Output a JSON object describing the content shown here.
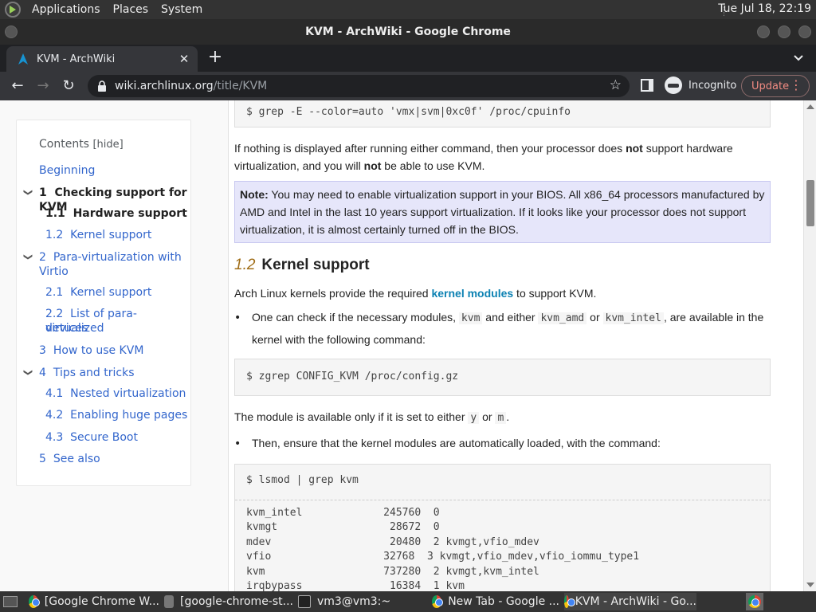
{
  "system_panel": {
    "menus": [
      "Applications",
      "Places",
      "System"
    ],
    "clock": "Tue Jul 18, 22:19"
  },
  "window": {
    "title": "KVM - ArchWiki - Google Chrome"
  },
  "tab": {
    "title": "KVM - ArchWiki",
    "close": "✕",
    "new_tab": "+"
  },
  "toolbar": {
    "url_host": "wiki.archlinux.org",
    "url_path": "/title/KVM",
    "incognito_label": "Incognito",
    "update_label": "Update"
  },
  "toc": {
    "title": "Contents",
    "hide": "[hide]",
    "items": [
      {
        "num": "",
        "label": "Beginning"
      },
      {
        "num": "1",
        "label": "Checking support for KVM"
      },
      {
        "num": "1.1",
        "label": "Hardware support"
      },
      {
        "num": "1.2",
        "label": "Kernel support"
      },
      {
        "num": "2",
        "label": "Para-virtualization with"
      },
      {
        "num": "",
        "label": "Virtio"
      },
      {
        "num": "2.1",
        "label": "Kernel support"
      },
      {
        "num": "2.2",
        "label": "List of para-virtualized"
      },
      {
        "num": "",
        "label": "devices"
      },
      {
        "num": "3",
        "label": "How to use KVM"
      },
      {
        "num": "4",
        "label": "Tips and tricks"
      },
      {
        "num": "4.1",
        "label": "Nested virtualization"
      },
      {
        "num": "4.2",
        "label": "Enabling huge pages"
      },
      {
        "num": "4.3",
        "label": "Secure Boot"
      },
      {
        "num": "5",
        "label": "See also"
      }
    ]
  },
  "content": {
    "code1": "$ grep -E --color=auto 'vmx|svm|0xc0f' /proc/cpuinfo",
    "p1_a": "If nothing is displayed after running either command, then your processor does ",
    "p1_not": "not",
    "p1_b": " support hardware virtualization, and you will ",
    "p1_not2": "not",
    "p1_c": " be able to use KVM.",
    "note_label": "Note:",
    "note_text": " You may need to enable virtualization support in your BIOS. All x86_64 processors manufactured by AMD and Intel in the last 10 years support virtualization. If it looks like your processor does not support virtualization, it is almost certainly turned off in the BIOS.",
    "heading_num": "1.2",
    "heading_text": "Kernel support",
    "p2_a": "Arch Linux kernels provide the required ",
    "p2_link": "kernel modules",
    "p2_b": " to support KVM.",
    "bullet1_a": "One can check if the necessary modules, ",
    "bullet1_kvm": "kvm",
    "bullet1_b": " and either ",
    "bullet1_amd": "kvm_amd",
    "bullet1_c": " or ",
    "bullet1_intel": "kvm_intel",
    "bullet1_d": ", are available in the kernel with the following command:",
    "code2": "$ zgrep CONFIG_KVM /proc/config.gz",
    "p3_a": "The module is available only if it is set to either ",
    "p3_y": "y",
    "p3_b": " or ",
    "p3_m": "m",
    "p3_c": ".",
    "bullet2": "Then, ensure that the kernel modules are automatically loaded, with the command:",
    "code3": "$ lsmod | grep kvm",
    "output": [
      "kvm_intel             245760  0",
      "kvmgt                  28672  0",
      "mdev                   20480  2 kvmgt,vfio_mdev",
      "vfio                  32768  3 kvmgt,vfio_mdev,vfio_iommu_type1",
      "kvm                   737280  2 kvmgt,kvm_intel",
      "irqbypass              16384  1 kvm"
    ]
  },
  "taskbar": {
    "tasks": [
      "[Google Chrome W...",
      "[google-chrome-st...",
      "vm3@vm3:~",
      "New Tab - Google ...",
      "KVM - ArchWiki - Go..."
    ]
  }
}
